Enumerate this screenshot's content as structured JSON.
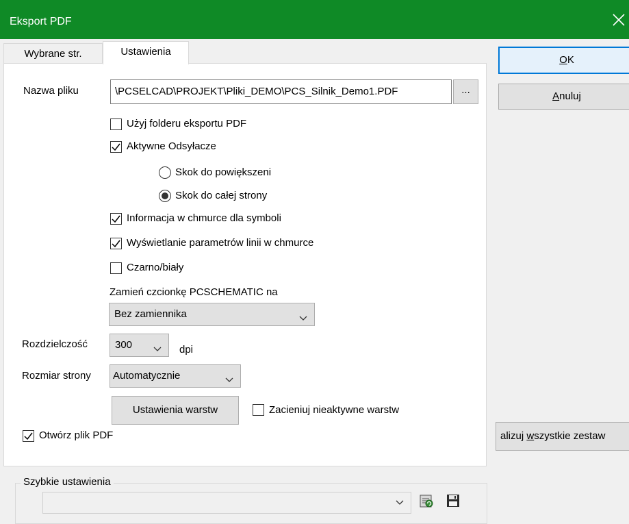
{
  "window": {
    "title": "Eksport PDF"
  },
  "tabs": [
    {
      "label": "Wybrane str."
    },
    {
      "label": "Ustawienia"
    }
  ],
  "file": {
    "label": "Nazwa pliku",
    "value": "\\PCSELCAD\\PROJEKT\\Pliki_DEMO\\PCS_Silnik_Demo1.PDF",
    "browse_label": "..."
  },
  "options": {
    "use_export_folder": {
      "label": "Użyj folderu eksportu PDF",
      "checked": false
    },
    "active_refs": {
      "label": "Aktywne Odsyłacze",
      "checked": true
    },
    "jump_zoom": {
      "label": "Skok do powiększeni",
      "selected": false
    },
    "jump_page": {
      "label": "Skok do całej strony",
      "selected": true
    },
    "tooltip_symbols": {
      "label": "Informacja w chmurce dla symboli",
      "checked": true
    },
    "line_params": {
      "label": "Wyświetlanie parametrów linii w chmurce",
      "checked": true
    },
    "black_white": {
      "label": "Czarno/biały",
      "checked": false
    }
  },
  "font_replace": {
    "label": "Zamień czcionkę PCSCHEMATIC na",
    "value": "Bez zamiennika"
  },
  "resolution": {
    "label": "Rozdzielczość",
    "value": "300",
    "unit": "dpi"
  },
  "page_size": {
    "label": "Rozmiar strony",
    "value": "Automatycznie"
  },
  "layers": {
    "button_label": "Ustawienia warstw",
    "shade_label": "Zacieniuj nieaktywne warstw",
    "shade_checked": false
  },
  "open_pdf": {
    "label": "Otwórz plik PDF",
    "checked": true
  },
  "quick_settings": {
    "label": "Szybkie ustawienia",
    "value": ""
  },
  "buttons": {
    "ok_prefix": "",
    "ok_mnemonic": "O",
    "ok_rest": "K",
    "cancel_mnemonic": "A",
    "cancel_rest": "nuluj",
    "update_prefix": "alizuj ",
    "update_mnemonic": "w",
    "update_rest": "szystkie zestaw"
  },
  "icons": {
    "close": "close-icon",
    "refresh": "refresh-icon",
    "save": "save-icon",
    "chevron": "chevron-down-icon"
  }
}
